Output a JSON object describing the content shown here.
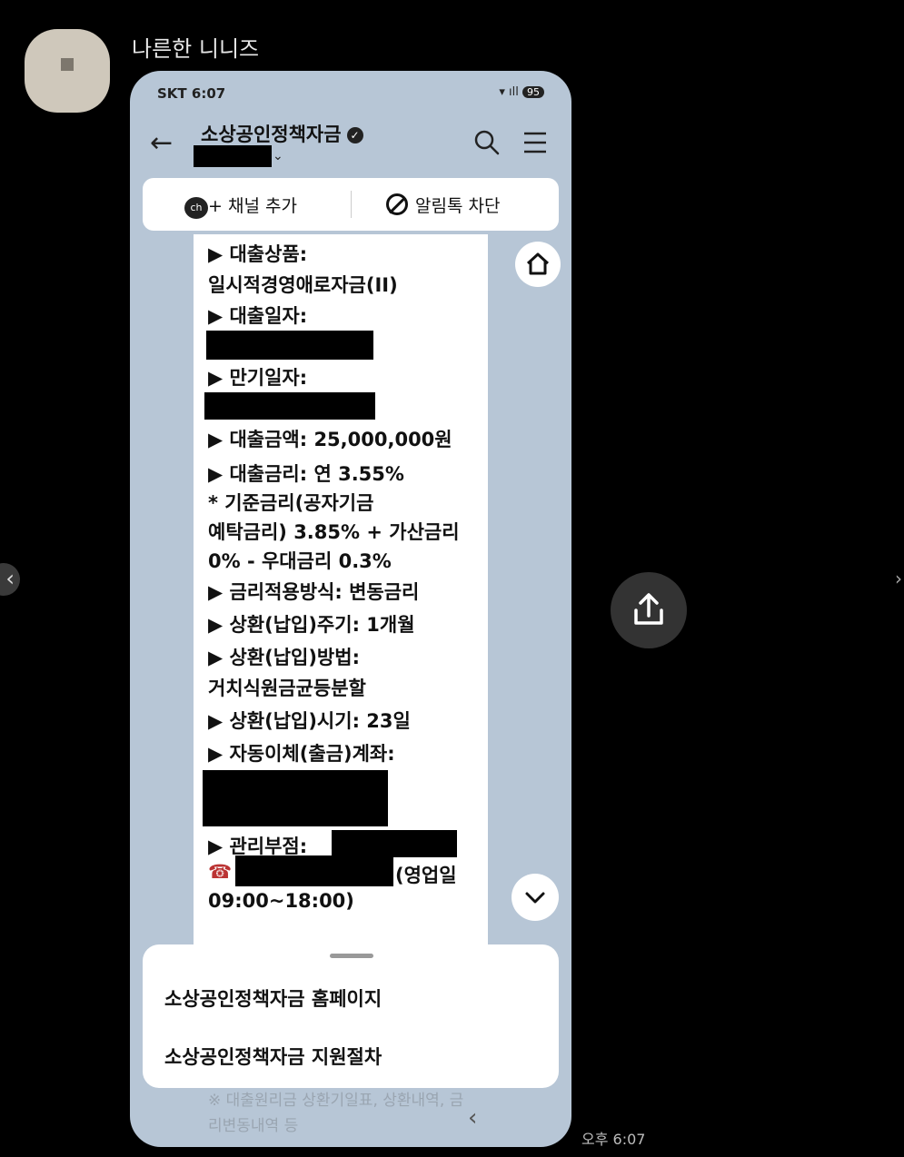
{
  "chat": {
    "sender_name": "나른한 니니즈",
    "message_time": "오후 6:07"
  },
  "phone": {
    "status_time": "SKT 6:07",
    "battery": "95",
    "channel_title": "소상공인정책자금",
    "add_channel": "+ 채널 추가",
    "ch_badge": "ch",
    "block_alert": "알림톡 차단",
    "message_lines": [
      "▶ 대출상품:",
      "일시적경영애로자금(II)",
      "▶ 대출일자:",
      "▶ 만기일자:",
      "▶ 대출금액: 25,000,000원",
      "▶ 대출금리: 연 3.55%",
      "  * 기준금리(공자기금",
      "예탁금리) 3.85% + 가산금리",
      "0% - 우대금리 0.3%",
      "▶ 금리적용방식: 변동금리",
      "▶ 상환(납입)주기: 1개월",
      "▶ 상환(납입)방법:",
      "거치식원금균등분할",
      "▶ 상환(납입)시기: 23일",
      "▶ 자동이체(출금)계좌:",
      "▶ 관리부점:",
      "(영업일",
      "09:00~18:00)"
    ],
    "sheet_items": [
      "소상공인정책자금 홈페이지",
      "소상공인정책자금 지원절차"
    ],
    "under_text": "※ 대출원리금 상환기일표, 상환내역, 금리변동내역 등"
  },
  "icons": [
    "back-arrow-icon",
    "verified-icon",
    "search-icon",
    "menu-icon",
    "block-icon",
    "home-icon",
    "chevron-down-icon",
    "share-icon",
    "phone-icon"
  ]
}
